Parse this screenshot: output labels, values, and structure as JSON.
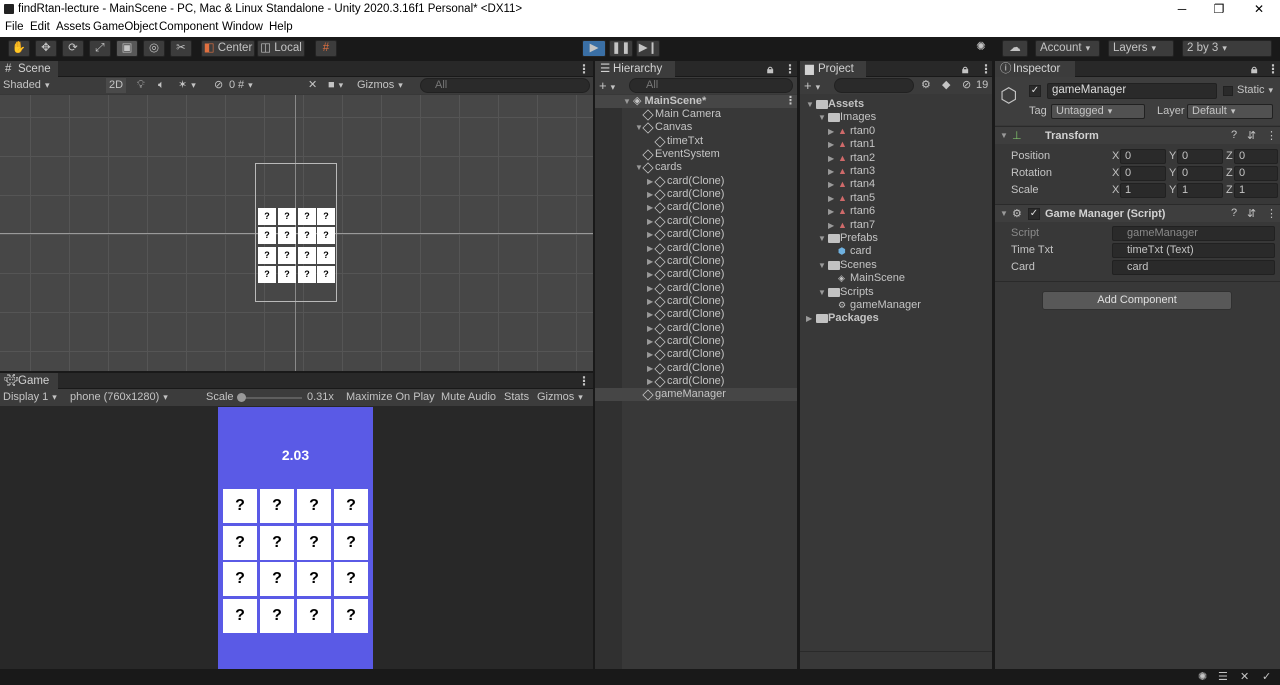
{
  "window": {
    "title": "findRtan-lecture - MainScene - PC, Mac & Linux Standalone - Unity 2020.3.16f1 Personal* <DX11>",
    "minimize": "─",
    "maximize": "❐",
    "close": "✕"
  },
  "menu": [
    "File",
    "Edit",
    "Assets",
    "GameObject",
    "Component",
    "Window",
    "Help"
  ],
  "toolbar": {
    "center": "Center",
    "local": "Local",
    "account": "Account",
    "layers": "Layers",
    "layout": "2 by 3",
    "play_icon": "play-icon",
    "pause_icon": "pause-icon",
    "step_icon": "step-icon"
  },
  "scene": {
    "tab": "Scene",
    "shading": "Shaded",
    "mode2d": "2D",
    "hidden_count": "0",
    "gizmos": "Gizmos",
    "search_placeholder": "All",
    "card_symbol": "?"
  },
  "game": {
    "tab": "Game",
    "display": "Display 1",
    "resolution": "phone (760x1280)",
    "scale_label": "Scale",
    "scale_value": "0.31x",
    "maximize": "Maximize On Play",
    "mute": "Mute Audio",
    "stats": "Stats",
    "gizmos": "Gizmos",
    "time_text": "2.03",
    "card_symbol": "?",
    "background": "#5a5ae6"
  },
  "hierarchy": {
    "tab": "Hierarchy",
    "search_placeholder": "All",
    "scene": "MainScene*",
    "items": [
      "Main Camera",
      "Canvas",
      "timeTxt",
      "EventSystem",
      "cards",
      "card(Clone)",
      "card(Clone)",
      "card(Clone)",
      "card(Clone)",
      "card(Clone)",
      "card(Clone)",
      "card(Clone)",
      "card(Clone)",
      "card(Clone)",
      "card(Clone)",
      "card(Clone)",
      "card(Clone)",
      "card(Clone)",
      "card(Clone)",
      "card(Clone)",
      "card(Clone)",
      "gameManager"
    ]
  },
  "project": {
    "tab": "Project",
    "hidden_count": "19",
    "items": [
      "Assets",
      "Images",
      "rtan0",
      "rtan1",
      "rtan2",
      "rtan3",
      "rtan4",
      "rtan5",
      "rtan6",
      "rtan7",
      "Prefabs",
      "card",
      "Scenes",
      "MainScene",
      "Scripts",
      "gameManager",
      "Packages"
    ]
  },
  "inspector": {
    "tab": "Inspector",
    "object_name": "gameManager",
    "static_label": "Static",
    "tag_label": "Tag",
    "tag_value": "Untagged",
    "layer_label": "Layer",
    "layer_value": "Default",
    "transform": {
      "title": "Transform",
      "rows": [
        {
          "label": "Position",
          "x": "0",
          "y": "0",
          "z": "0"
        },
        {
          "label": "Rotation",
          "x": "0",
          "y": "0",
          "z": "0"
        },
        {
          "label": "Scale",
          "x": "1",
          "y": "1",
          "z": "1"
        }
      ],
      "axis_x": "X",
      "axis_y": "Y",
      "axis_z": "Z"
    },
    "script_component": {
      "title": "Game Manager (Script)",
      "script_label": "Script",
      "script_value": "gameManager",
      "time_label": "Time Txt",
      "time_value": "timeTxt (Text)",
      "card_label": "Card",
      "card_value": "card"
    },
    "add_component": "Add Component"
  }
}
